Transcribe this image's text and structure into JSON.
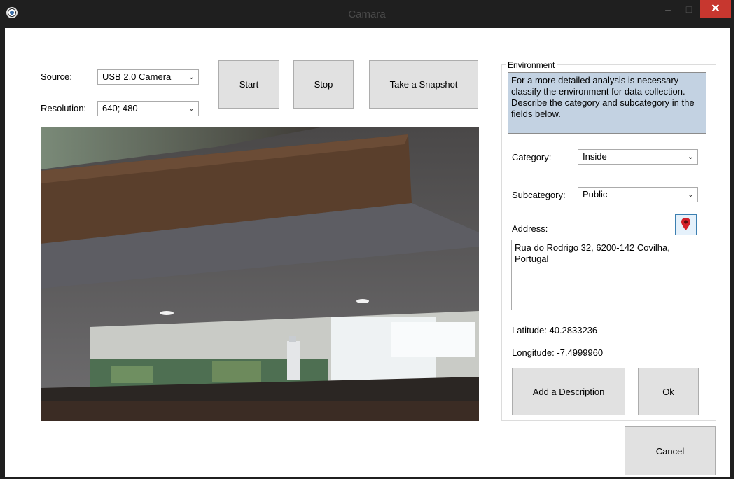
{
  "window": {
    "title": "Camara",
    "minimize_glyph": "–",
    "maximize_glyph": "□",
    "close_glyph": "✕"
  },
  "camera": {
    "source_label": "Source:",
    "source_value": "USB 2.0 Camera",
    "resolution_label": "Resolution:",
    "resolution_value": "640; 480",
    "start_label": "Start",
    "stop_label": "Stop",
    "snapshot_label": "Take a Snapshot"
  },
  "environment": {
    "legend": "Environment",
    "info": "For a more detailed analysis is necessary classify the environment for data collection. Describe the category and subcategory in the fields below.",
    "category_label": "Category:",
    "category_value": "Inside",
    "subcategory_label": "Subcategory:",
    "subcategory_value": "Public",
    "address_label": "Address:",
    "address_value": "Rua do Rodrigo 32, 6200-142 Covilha, Portugal",
    "latitude": "Latitude: 40.2833236",
    "longitude": "Longitude: -7.4999960",
    "add_description_label": "Add a Description",
    "ok_label": "Ok"
  },
  "footer": {
    "cancel_label": "Cancel"
  },
  "icons": {
    "app": "webcam-icon",
    "map_pin": "map-pin-icon",
    "dropdown": "chevron-down-icon"
  },
  "colors": {
    "info_background": "#c3d2e2",
    "close_button": "#c7372f",
    "pin": "#d3202a"
  }
}
